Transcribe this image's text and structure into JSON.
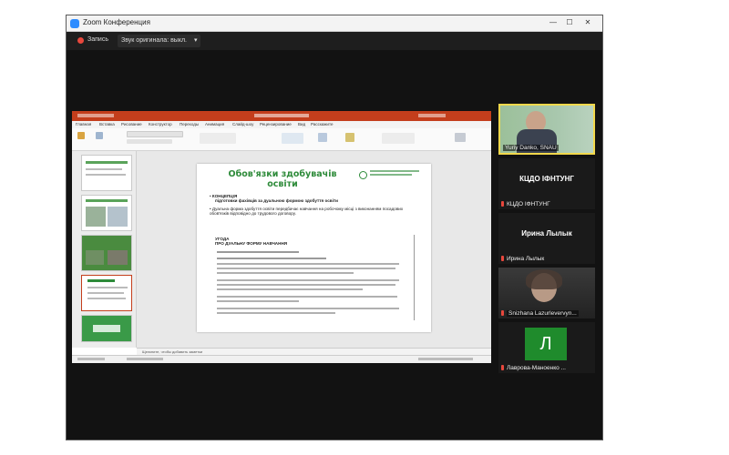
{
  "window": {
    "title": "Zoom Конференция",
    "controls": [
      "—",
      "☐",
      "✕"
    ]
  },
  "toolbar": {
    "record_label": "Запись",
    "audio_label": "Звук оригинала: выкл.",
    "audio_arrow": "▾"
  },
  "colors": {
    "zoom_blue": "#2d8cff",
    "ppt_red": "#c43e1c",
    "slide_green": "#2e8b3a",
    "active_speaker": "#f2d84b",
    "mic_muted": "#e8473c"
  },
  "powerpoint": {
    "tabs": [
      "Главная",
      "Вставка",
      "Рисование",
      "Конструктор",
      "Переходы",
      "Анимация",
      "Слайд-шоу",
      "Рецензирование",
      "Вид",
      "Расскажите"
    ]
  },
  "slide": {
    "title_line1": "Обов'язки здобувачів",
    "title_line2": "освіти",
    "bullet1_heading": "КОНЦЕПЦІЯ",
    "bullet1_text": "підготовки фахівців за дуальною формою здобуття освіти",
    "bullet2_text": "Дуальна форма здобуття освіти передбачає навчання на робочому місці з виконанням посадових обов'язків відповідно до трудового договору.",
    "agreement_heading": "УГОДА",
    "agreement_subheading": "ПРО ДУАЛЬНУ ФОРМУ НАВЧАННЯ"
  },
  "notes": {
    "placeholder": "Щелкните, чтобы добавить заметки"
  },
  "participants": [
    {
      "name": "Yuriy Danko, SNAU",
      "type": "video",
      "active": true,
      "muted": false
    },
    {
      "name": "КЦДО ІФНТУНГ",
      "type": "name",
      "display": "КЦДО ІФНТУНГ",
      "muted": true
    },
    {
      "name": "Ирина Лылык",
      "type": "name",
      "display": "Ирина Лылык",
      "muted": true
    },
    {
      "name": "Snizhana Lazurlevervyn...",
      "type": "video",
      "active": false,
      "muted": true
    },
    {
      "name": "Лаврова-Маноенко ...",
      "type": "avatar",
      "initial": "Л",
      "muted": true
    }
  ]
}
